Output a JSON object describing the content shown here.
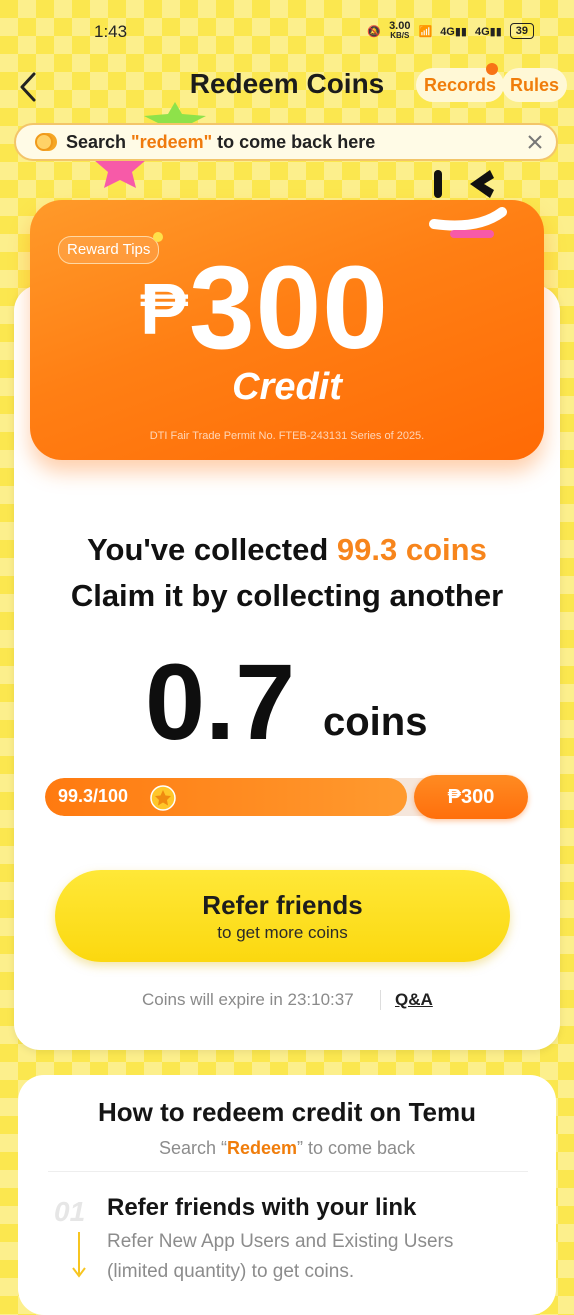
{
  "status": {
    "time": "1:43",
    "speed": "3.00",
    "speed_unit": "KB/S",
    "battery": "39"
  },
  "header": {
    "title": "Redeem Coins",
    "records": "Records",
    "rules": "Rules"
  },
  "search_banner": {
    "prefix": "Search ",
    "keyword": "\"redeem\"",
    "suffix": " to come back here"
  },
  "credit_card": {
    "badge": "Reward Tips",
    "currency": "₱",
    "amount": "300",
    "label": "Credit",
    "permit": "DTI Fair Trade Permit No. FTEB-243131 Series of 2025."
  },
  "progress_info": {
    "collected_prefix": "You've collected ",
    "collected_value": "99.3 coins",
    "claim_text": "Claim it by collecting another",
    "remaining": "0.7",
    "remaining_unit": "coins",
    "progress_label": "99.3/100",
    "progress_fraction": 0.993,
    "target": "₱300"
  },
  "refer": {
    "title": "Refer friends",
    "subtitle": "to get more coins"
  },
  "expiry": {
    "text": "Coins will expire in 23:10:37",
    "qa": "Q&A"
  },
  "how_to": {
    "title": "How to redeem credit on Temu",
    "sub_prefix": "Search “",
    "sub_keyword": "Redeem",
    "sub_suffix": "” to come back",
    "steps": [
      {
        "num": "01",
        "title": "Refer friends with your link",
        "desc": "Refer New App Users and Existing Users (limited quantity) to get coins."
      }
    ]
  }
}
